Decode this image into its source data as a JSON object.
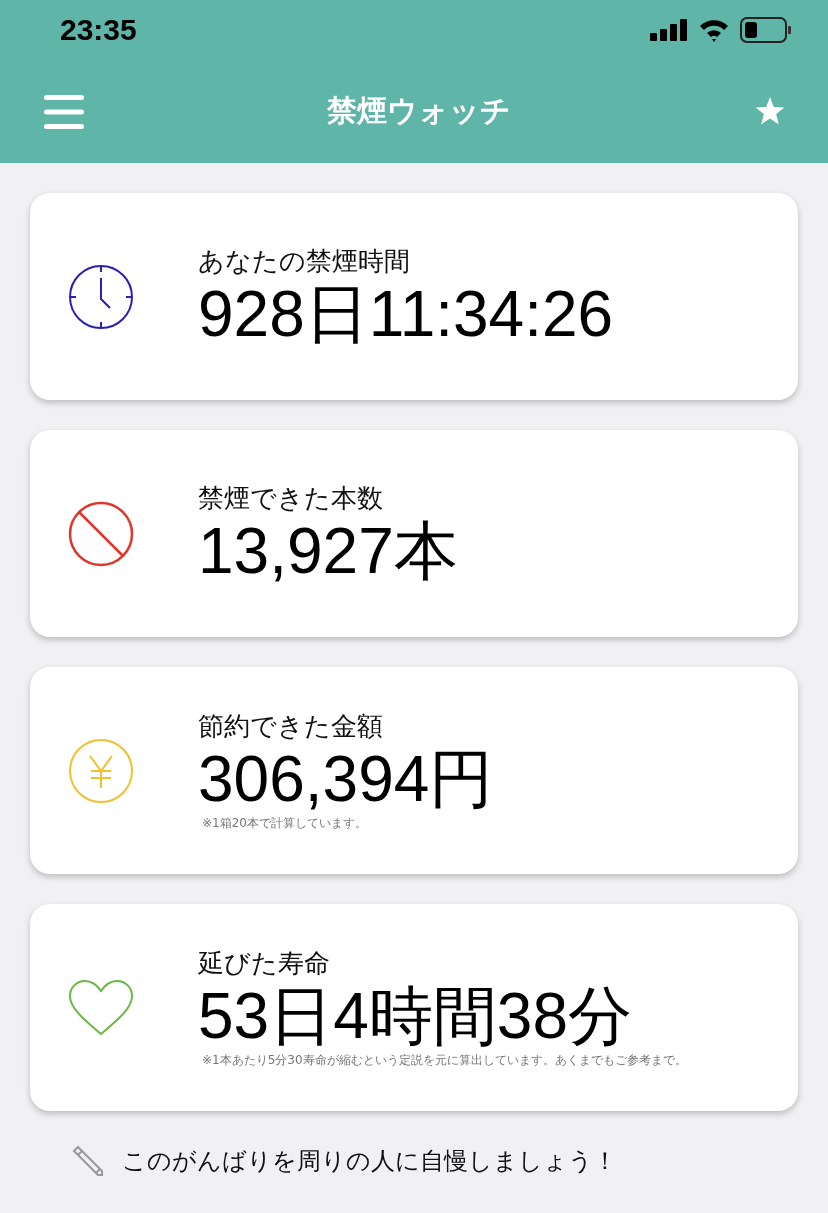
{
  "status_bar": {
    "time": "23:35"
  },
  "header": {
    "title": "禁煙ウォッチ"
  },
  "cards": [
    {
      "kind": "clock",
      "color": "#2a1fb0",
      "label": "あなたの禁煙時間",
      "value": "928日11:34:26"
    },
    {
      "kind": "prohibited",
      "color": "#e0352b",
      "label": "禁煙できた本数",
      "value": "13,927本"
    },
    {
      "kind": "yen",
      "color": "#f0c030",
      "label": "節約できた金額",
      "value": "306,394円",
      "note": "※1箱20本で計算しています。"
    },
    {
      "kind": "heart",
      "color": "#6ab841",
      "label": "延びた寿命",
      "value": "53日4時間38分",
      "note": "※1本あたり5分30寿命が縮むという定説を元に算出しています。あくまでもご参考まで。"
    }
  ],
  "footer": {
    "text": "このがんばりを周りの人に自慢しましょう！"
  }
}
